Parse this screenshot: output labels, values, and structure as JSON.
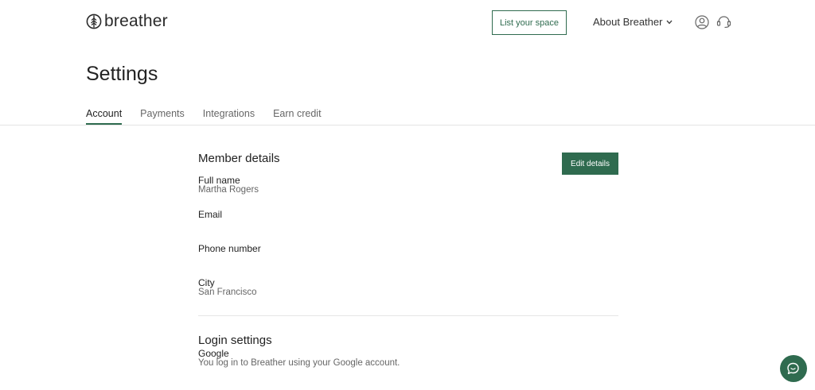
{
  "header": {
    "logo_text": "breather",
    "list_space_label": "List your space",
    "about_label": "About Breather"
  },
  "page": {
    "title": "Settings"
  },
  "tabs": [
    {
      "label": "Account",
      "active": true
    },
    {
      "label": "Payments",
      "active": false
    },
    {
      "label": "Integrations",
      "active": false
    },
    {
      "label": "Earn credit",
      "active": false
    }
  ],
  "member_details": {
    "title": "Member details",
    "edit_label": "Edit details",
    "fields": [
      {
        "label": "Full name",
        "value": "Martha Rogers"
      },
      {
        "label": "Email",
        "value": ""
      },
      {
        "label": "Phone number",
        "value": ""
      },
      {
        "label": "City",
        "value": "San Francisco"
      }
    ]
  },
  "login_settings": {
    "title": "Login settings",
    "provider": "Google",
    "description": "You log in to Breather using your Google account."
  },
  "icons": {
    "logo": "tree-logo-icon",
    "user": "user-account-icon",
    "support": "headset-support-icon",
    "chat": "chat-bubbles-icon",
    "chevron": "chevron-down-icon"
  },
  "colors": {
    "brand_green": "#2f6b4f"
  }
}
